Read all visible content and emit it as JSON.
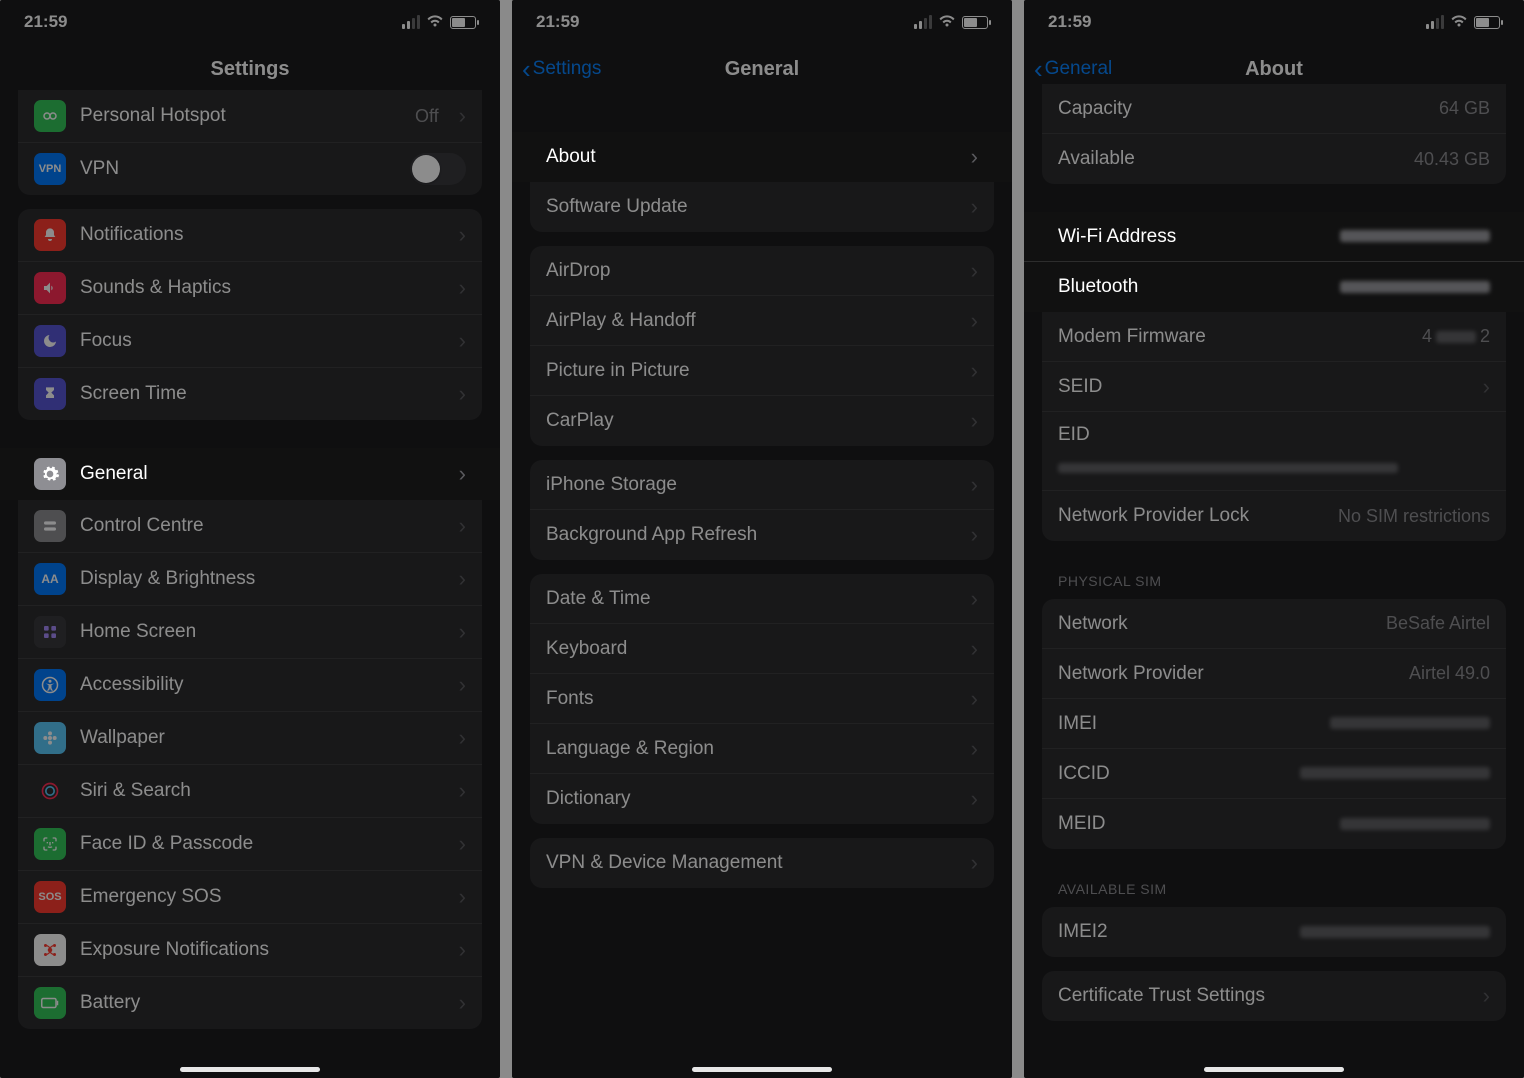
{
  "status": {
    "time": "21:59",
    "wifi": "􀙇",
    "battery": ""
  },
  "screen1": {
    "title": "Settings",
    "hotspot": {
      "label": "Personal Hotspot",
      "value": "Off"
    },
    "vpn": {
      "label": "VPN"
    },
    "items1": [
      {
        "label": "Notifications"
      },
      {
        "label": "Sounds & Haptics"
      },
      {
        "label": "Focus"
      },
      {
        "label": "Screen Time"
      }
    ],
    "general": {
      "label": "General"
    },
    "items2": [
      {
        "label": "Control Centre"
      },
      {
        "label": "Display & Brightness"
      },
      {
        "label": "Home Screen"
      },
      {
        "label": "Accessibility"
      },
      {
        "label": "Wallpaper"
      },
      {
        "label": "Siri & Search"
      },
      {
        "label": "Face ID & Passcode"
      },
      {
        "label": "Emergency SOS"
      },
      {
        "label": "Exposure Notifications"
      },
      {
        "label": "Battery"
      }
    ]
  },
  "screen2": {
    "back": "Settings",
    "title": "General",
    "about": {
      "label": "About"
    },
    "software": {
      "label": "Software Update"
    },
    "group2": [
      {
        "label": "AirDrop"
      },
      {
        "label": "AirPlay & Handoff"
      },
      {
        "label": "Picture in Picture"
      },
      {
        "label": "CarPlay"
      }
    ],
    "group3": [
      {
        "label": "iPhone Storage"
      },
      {
        "label": "Background App Refresh"
      }
    ],
    "group4": [
      {
        "label": "Date & Time"
      },
      {
        "label": "Keyboard"
      },
      {
        "label": "Fonts"
      },
      {
        "label": "Language & Region"
      },
      {
        "label": "Dictionary"
      }
    ],
    "group5": [
      {
        "label": "VPN & Device Management"
      }
    ]
  },
  "screen3": {
    "back": "General",
    "title": "About",
    "capacityLabel": "Capacity",
    "capacityValue": "64 GB",
    "availableLabel": "Available",
    "availableValue": "40.43 GB",
    "wifiLabel": "Wi-Fi Address",
    "btLabel": "Bluetooth",
    "modemLabel": "Modem Firmware",
    "modemPrefix": "4",
    "modemSuffix": "2",
    "seidLabel": "SEID",
    "eidLabel": "EID",
    "nplLabel": "Network Provider Lock",
    "nplValue": "No SIM restrictions",
    "physicalHeader": "PHYSICAL SIM",
    "networkLabel": "Network",
    "networkValue": "BeSafe Airtel",
    "providerLabel": "Network Provider",
    "providerValue": "Airtel 49.0",
    "imeiLabel": "IMEI",
    "iccidLabel": "ICCID",
    "meidLabel": "MEID",
    "availableSimHeader": "AVAILABLE SIM",
    "imei2Label": "IMEI2",
    "certLabel": "Certificate Trust Settings"
  }
}
